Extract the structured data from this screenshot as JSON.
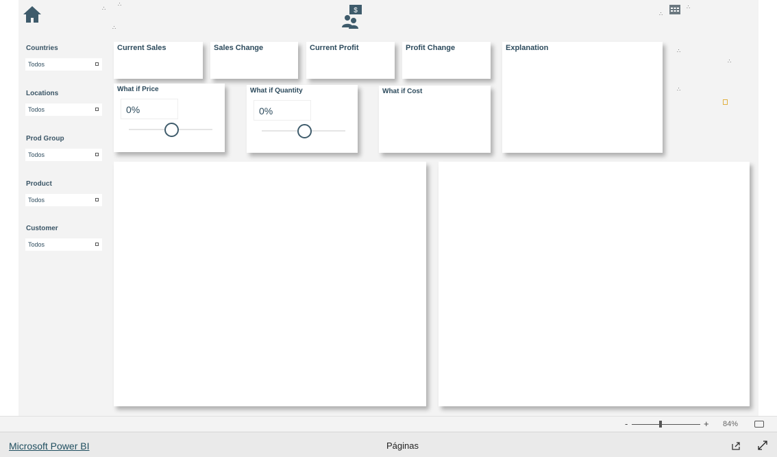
{
  "slicers": [
    {
      "label": "Countries",
      "value": "Todos"
    },
    {
      "label": "Locations",
      "value": "Todos"
    },
    {
      "label": "Prod Group",
      "value": "Todos"
    },
    {
      "label": "Product",
      "value": "Todos"
    },
    {
      "label": "Customer",
      "value": "Todos"
    }
  ],
  "cards": {
    "current_sales": "Current Sales",
    "sales_change": "Sales Change",
    "current_profit": "Current Profit",
    "profit_change": "Profit Change",
    "explanation": "Explanation"
  },
  "whatif": [
    {
      "title": "What if Price",
      "value": "0%",
      "slider": 0.5
    },
    {
      "title": "What if Quantity",
      "value": "0%",
      "slider": 0.5
    }
  ],
  "whatif_cost": "What if Cost",
  "zoom": {
    "minus": "-",
    "plus": "+",
    "level": "84%"
  },
  "footer": {
    "brand": "Microsoft Power BI",
    "pages": "Páginas"
  },
  "colors": {
    "accent": "#2c4a5c",
    "canvas": "#f3f3f3"
  }
}
